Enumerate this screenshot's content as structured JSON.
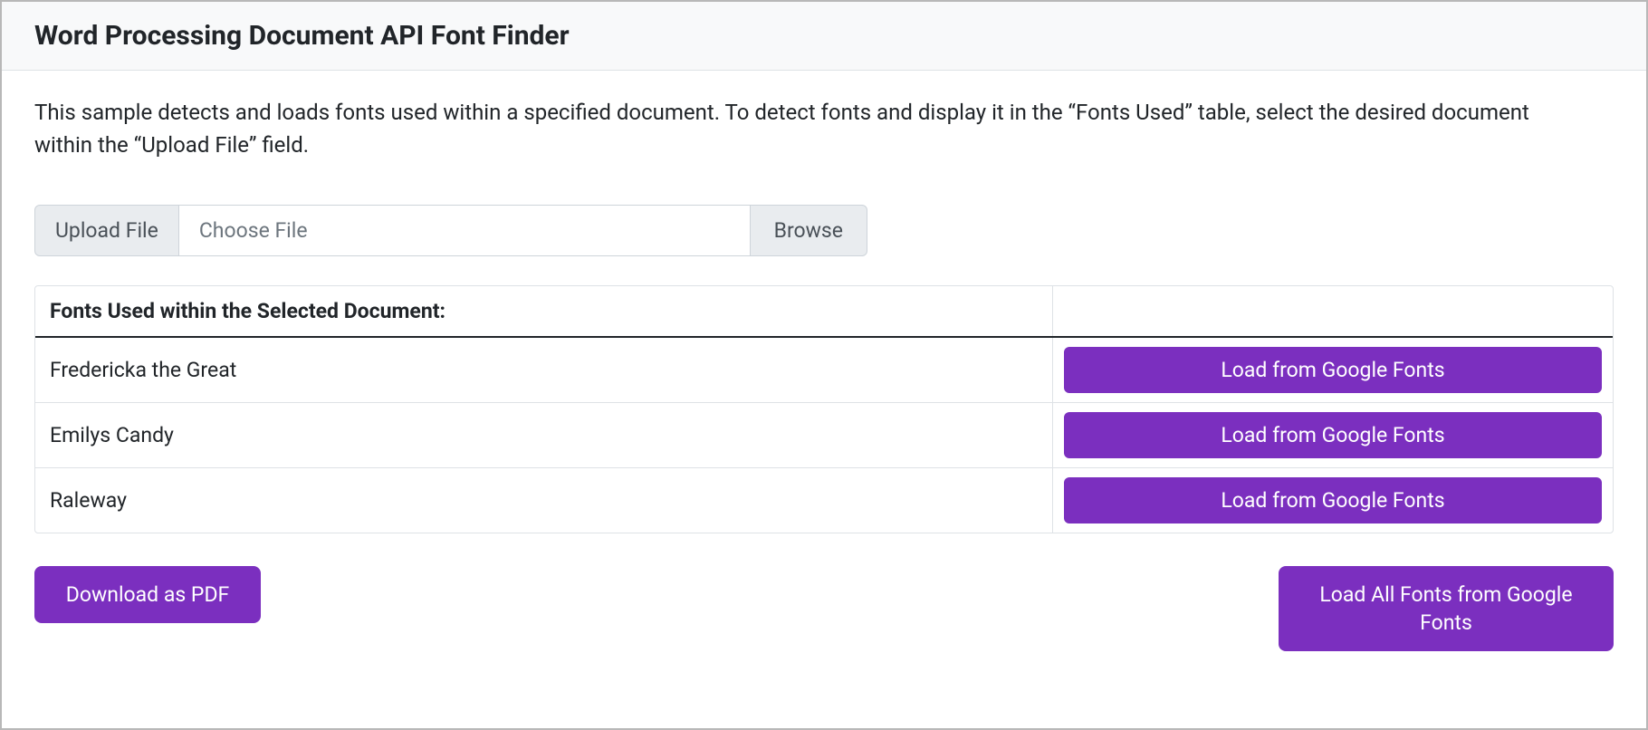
{
  "header": {
    "title": "Word Processing Document API Font Finder"
  },
  "description": "This sample detects and loads fonts used within a specified document. To detect fonts and display it in the “Fonts Used” table, select the desired document within the “Upload File” field.",
  "upload": {
    "label": "Upload File",
    "placeholder": "Choose File",
    "browse_label": "Browse"
  },
  "table": {
    "header": "Fonts Used within the Selected Document:",
    "load_button_label": "Load from Google Fonts",
    "rows": [
      {
        "name": "Fredericka the Great"
      },
      {
        "name": "Emilys Candy"
      },
      {
        "name": "Raleway"
      }
    ]
  },
  "actions": {
    "download_pdf": "Download as PDF",
    "load_all": "Load All Fonts from Google Fonts"
  }
}
